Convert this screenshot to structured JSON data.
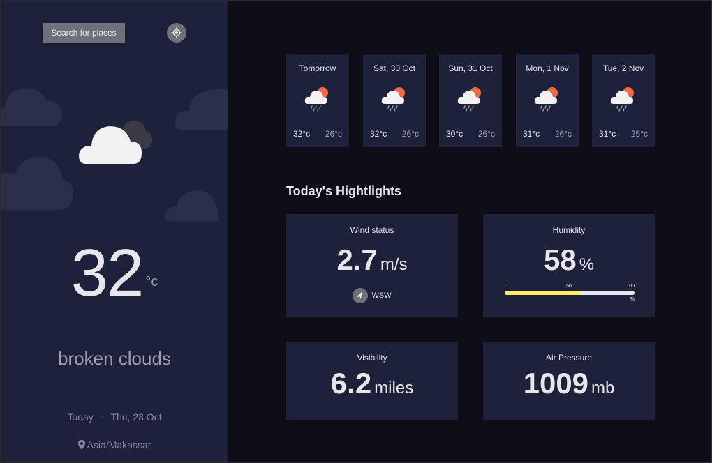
{
  "sidebar": {
    "search_label": "Search for places",
    "temperature": "32",
    "temperature_unit": "°c",
    "description": "broken clouds",
    "date_prefix": "Today",
    "date_separator": "·",
    "date": "Thu, 28 Oct",
    "location": "Asia/Makassar"
  },
  "forecast": [
    {
      "day": "Tomorrow",
      "max": "32°c",
      "min": "26°c",
      "icon": "rain-sun-icon"
    },
    {
      "day": "Sat, 30 Oct",
      "max": "32°c",
      "min": "26°c",
      "icon": "rain-sun-icon"
    },
    {
      "day": "Sun, 31 Oct",
      "max": "30°c",
      "min": "26°c",
      "icon": "rain-sun-icon"
    },
    {
      "day": "Mon, 1 Nov",
      "max": "31°c",
      "min": "26°c",
      "icon": "rain-sun-icon"
    },
    {
      "day": "Tue, 2 Nov",
      "max": "31°c",
      "min": "25°c",
      "icon": "rain-sun-icon"
    }
  ],
  "highlights": {
    "title": "Today's Hightlights",
    "wind": {
      "label": "Wind status",
      "value": "2.7",
      "unit": "m/s",
      "direction": "WSW"
    },
    "humidity": {
      "label": "Humidity",
      "value": "58",
      "unit": "%",
      "tick_0": "0",
      "tick_50": "50",
      "tick_100": "100",
      "bar_unit": "%",
      "fraction": 0.58
    },
    "visibility": {
      "label": "Visibility",
      "value": "6.2",
      "unit": "miles"
    },
    "pressure": {
      "label": "Air Pressure",
      "value": "1009",
      "unit": "mb"
    }
  },
  "colors": {
    "sidebar_bg": "#1e213a",
    "page_bg": "#0f0e17",
    "button_gray": "#6e707a",
    "humidity_fill": "#ffec65",
    "sun": "#f06a4a"
  }
}
